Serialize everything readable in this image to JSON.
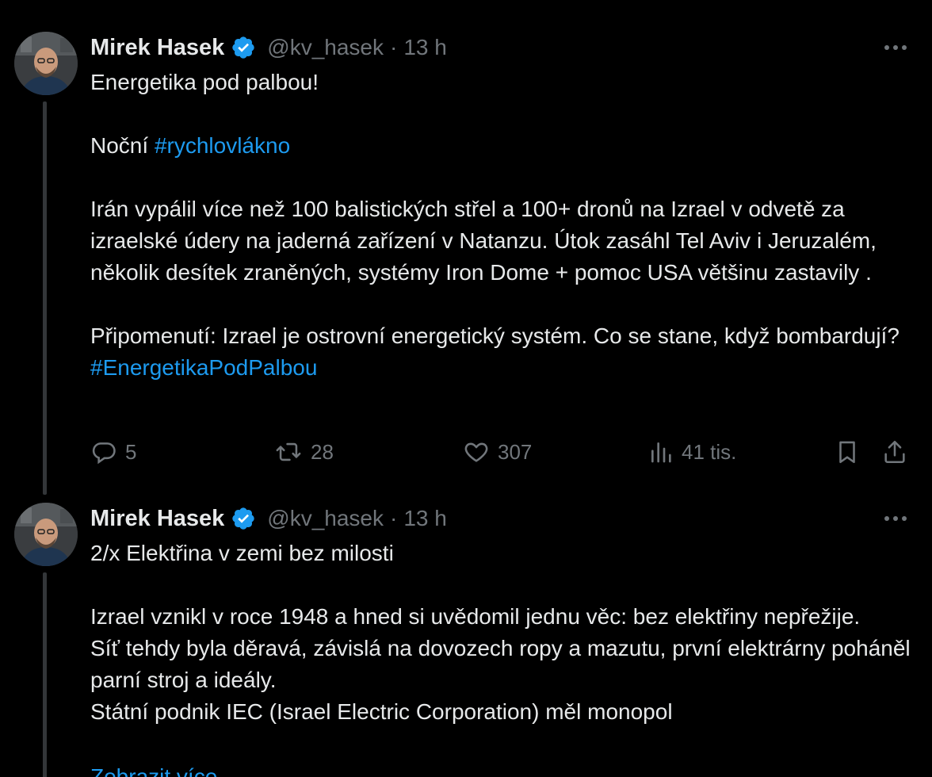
{
  "tweets": [
    {
      "author_name": "Mirek Hasek",
      "handle": "@kv_hasek",
      "separator": "·",
      "time": "13 h",
      "paragraphs": [
        {
          "text": "Energetika pod palbou!"
        },
        {
          "prefix": "Noční ",
          "hashtag": "#rychlovlákno"
        },
        {
          "text": "Irán vypálil více než 100 balistických střel a 100+ dronů na Izrael v odvetě za izraelské údery na jaderná zařízení v Natanzu. Útok zasáhl Tel Aviv i Jeruzalém, několik desítek zraněných, systémy Iron Dome + pomoc USA většinu zastavily   ."
        },
        {
          "prefix": "Připomenutí: Izrael je ostrovní energetický systém. Co se stane, když bombardují? ",
          "hashtag": "#EnergetikaPodPalbou"
        }
      ],
      "actions": {
        "replies": "5",
        "reposts": "28",
        "likes": "307",
        "views": "41 tis."
      }
    },
    {
      "author_name": "Mirek Hasek",
      "handle": "@kv_hasek",
      "separator": "·",
      "time": "13 h",
      "paragraphs": [
        {
          "text": "2/x Elektřina v zemi bez milosti"
        },
        {
          "text": "Izrael vznikl v roce 1948 a hned si uvědomil jednu věc: bez elektřiny nepřežije.\nSíť tehdy byla děravá, závislá na dovozech ropy a mazutu, první elektrárny poháněl parní stroj a ideály.\nStátní podnik IEC (Israel Electric Corporation) měl monopol"
        }
      ],
      "show_more": "Zobrazit více"
    }
  ],
  "icons": {
    "verified": "verified-badge-icon",
    "more": "more-dots-icon",
    "reply": "reply-icon",
    "repost": "repost-icon",
    "like": "heart-icon",
    "views": "views-chart-icon",
    "bookmark": "bookmark-icon",
    "share": "share-icon"
  },
  "colors": {
    "background": "#000000",
    "text": "#e7e9ea",
    "secondary": "#71767b",
    "accent": "#1d9bf0"
  }
}
